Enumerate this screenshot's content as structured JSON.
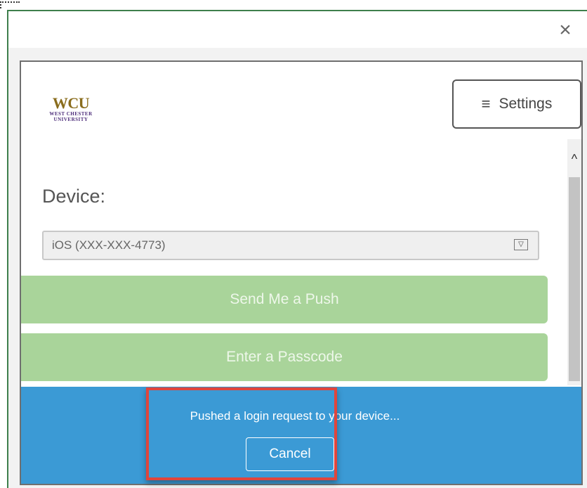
{
  "modal": {
    "close_icon": "close-icon"
  },
  "logo": {
    "name": "WCU",
    "line1": "WEST CHESTER",
    "line2": "UNIVERSITY"
  },
  "settings": {
    "icon": "hamburger-icon",
    "label": "Settings"
  },
  "device": {
    "label": "Device:",
    "selected": "iOS (XXX-XXX-4773)"
  },
  "buttons": {
    "push": "Send Me a Push",
    "passcode": "Enter a Passcode"
  },
  "status": {
    "message": "Pushed a login request to your device...",
    "cancel": "Cancel"
  },
  "colors": {
    "green_button": "#a9d49a",
    "status_blue": "#3b9ad5",
    "highlight_red": "#e0453c",
    "logo_gold": "#8a6d1d",
    "logo_purple": "#4b2b79"
  }
}
